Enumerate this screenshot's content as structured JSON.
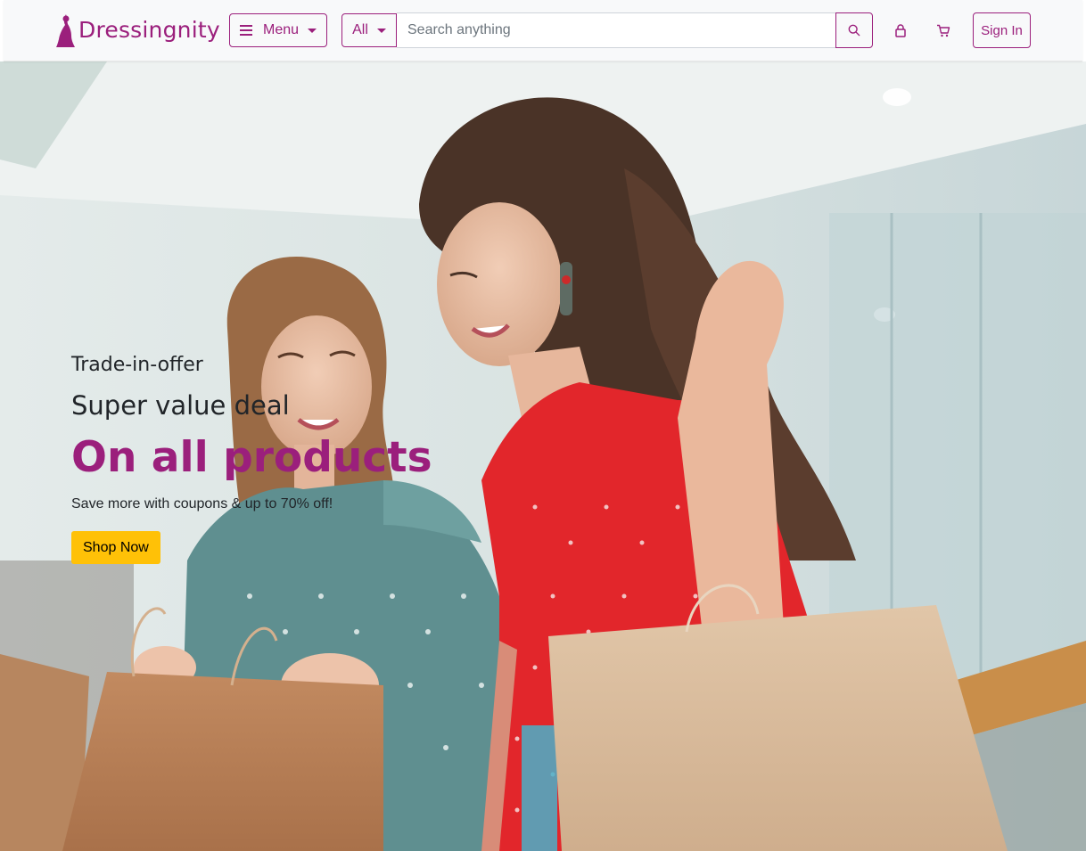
{
  "header": {
    "brand_name": "Dressingnity",
    "menu_label": "Menu",
    "category_label": "All",
    "search_placeholder": "Search anything",
    "sign_in_label": "Sign In",
    "icons": [
      "hamburger-icon",
      "search-icon",
      "lock-icon",
      "cart-icon"
    ]
  },
  "hero": {
    "eyebrow": "Trade-in-offer",
    "subtitle": "Super value deal",
    "title": "On all products",
    "description": "Save more with coupons & up to 70% off!",
    "cta_label": "Shop Now"
  },
  "colors": {
    "brand": "#9b1f7c",
    "cta": "#ffc107",
    "header_bg": "#f8f9fa"
  }
}
